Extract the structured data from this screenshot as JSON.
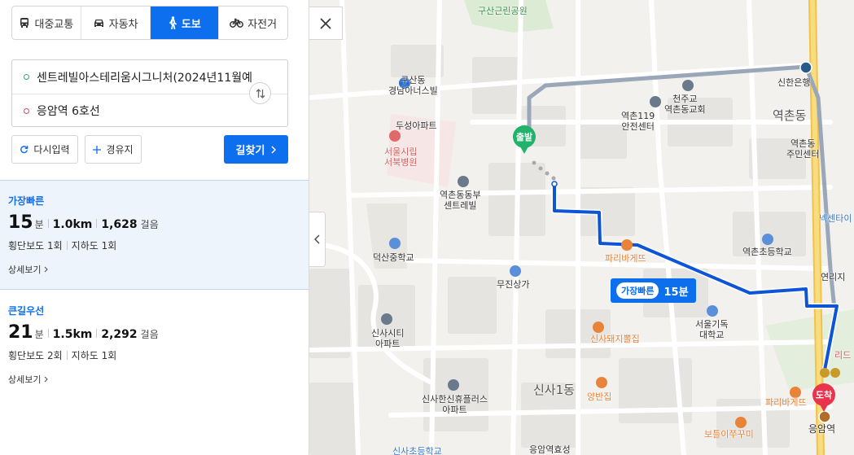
{
  "transport_modes": [
    {
      "label": "대중교통",
      "icon": "bus-icon",
      "active": false
    },
    {
      "label": "자동차",
      "icon": "car-icon",
      "active": false
    },
    {
      "label": "도보",
      "icon": "walk-icon",
      "active": true
    },
    {
      "label": "자전거",
      "icon": "bicycle-icon",
      "active": false
    }
  ],
  "route": {
    "origin": "센트레빌아스테리움시그니처(2024년11월예",
    "destination": "응암역 6호선"
  },
  "buttons": {
    "reset": "다시입력",
    "waypoint": "경유지",
    "search": "길찾기"
  },
  "results": [
    {
      "title": "가장빠른",
      "minutes": "15",
      "minutes_unit": "분",
      "distance": "1.0km",
      "steps": "1,628",
      "steps_unit": "걸음",
      "crosswalk": "횡단보도 1회",
      "underpass": "지하도 1회",
      "detail": "상세보기"
    },
    {
      "title": "큰길우선",
      "minutes": "21",
      "minutes_unit": "분",
      "distance": "1.5km",
      "steps": "2,292",
      "steps_unit": "걸음",
      "crosswalk": "횡단보도 2회",
      "underpass": "지하도 1회",
      "detail": "상세보기"
    }
  ],
  "map": {
    "eta_tag": "가장빠른",
    "eta_time": "15분",
    "start_pin": "출발",
    "end_pin": "도착",
    "labels": {
      "park": "구산근린공원",
      "apt1": "구산동\n경남아너스빌",
      "bank": "신한은행",
      "church": "천주교\n역촌동교회",
      "safety": "역촌119\n안전센터",
      "district": "역촌동",
      "hospital": "서울시립\n서북병원",
      "apt2": "두성아파트",
      "apt3": "역촌동동부\n센트레빌",
      "office": "역촌동\n주민센터",
      "pizza1": "파리바게뜨",
      "school1": "역촌초등학교",
      "midschool": "덕산중학교",
      "mall": "무진상가",
      "library": "넥센타이",
      "college": "서울기독\n대학교",
      "apt4": "신사시티\n아파트",
      "restaurant1": "신사돼지뽈집",
      "ref": "연리지",
      "area": "신사1동",
      "apt5": "신사한신휴플러스\n아파트",
      "rest2": "양반집",
      "pizza2": "파리바게뜨",
      "cafe": "보틀이쭈꾸미",
      "station": "응암역",
      "apt6": "응암역효성",
      "school2": "신사초등학교",
      "red": "리드"
    }
  }
}
